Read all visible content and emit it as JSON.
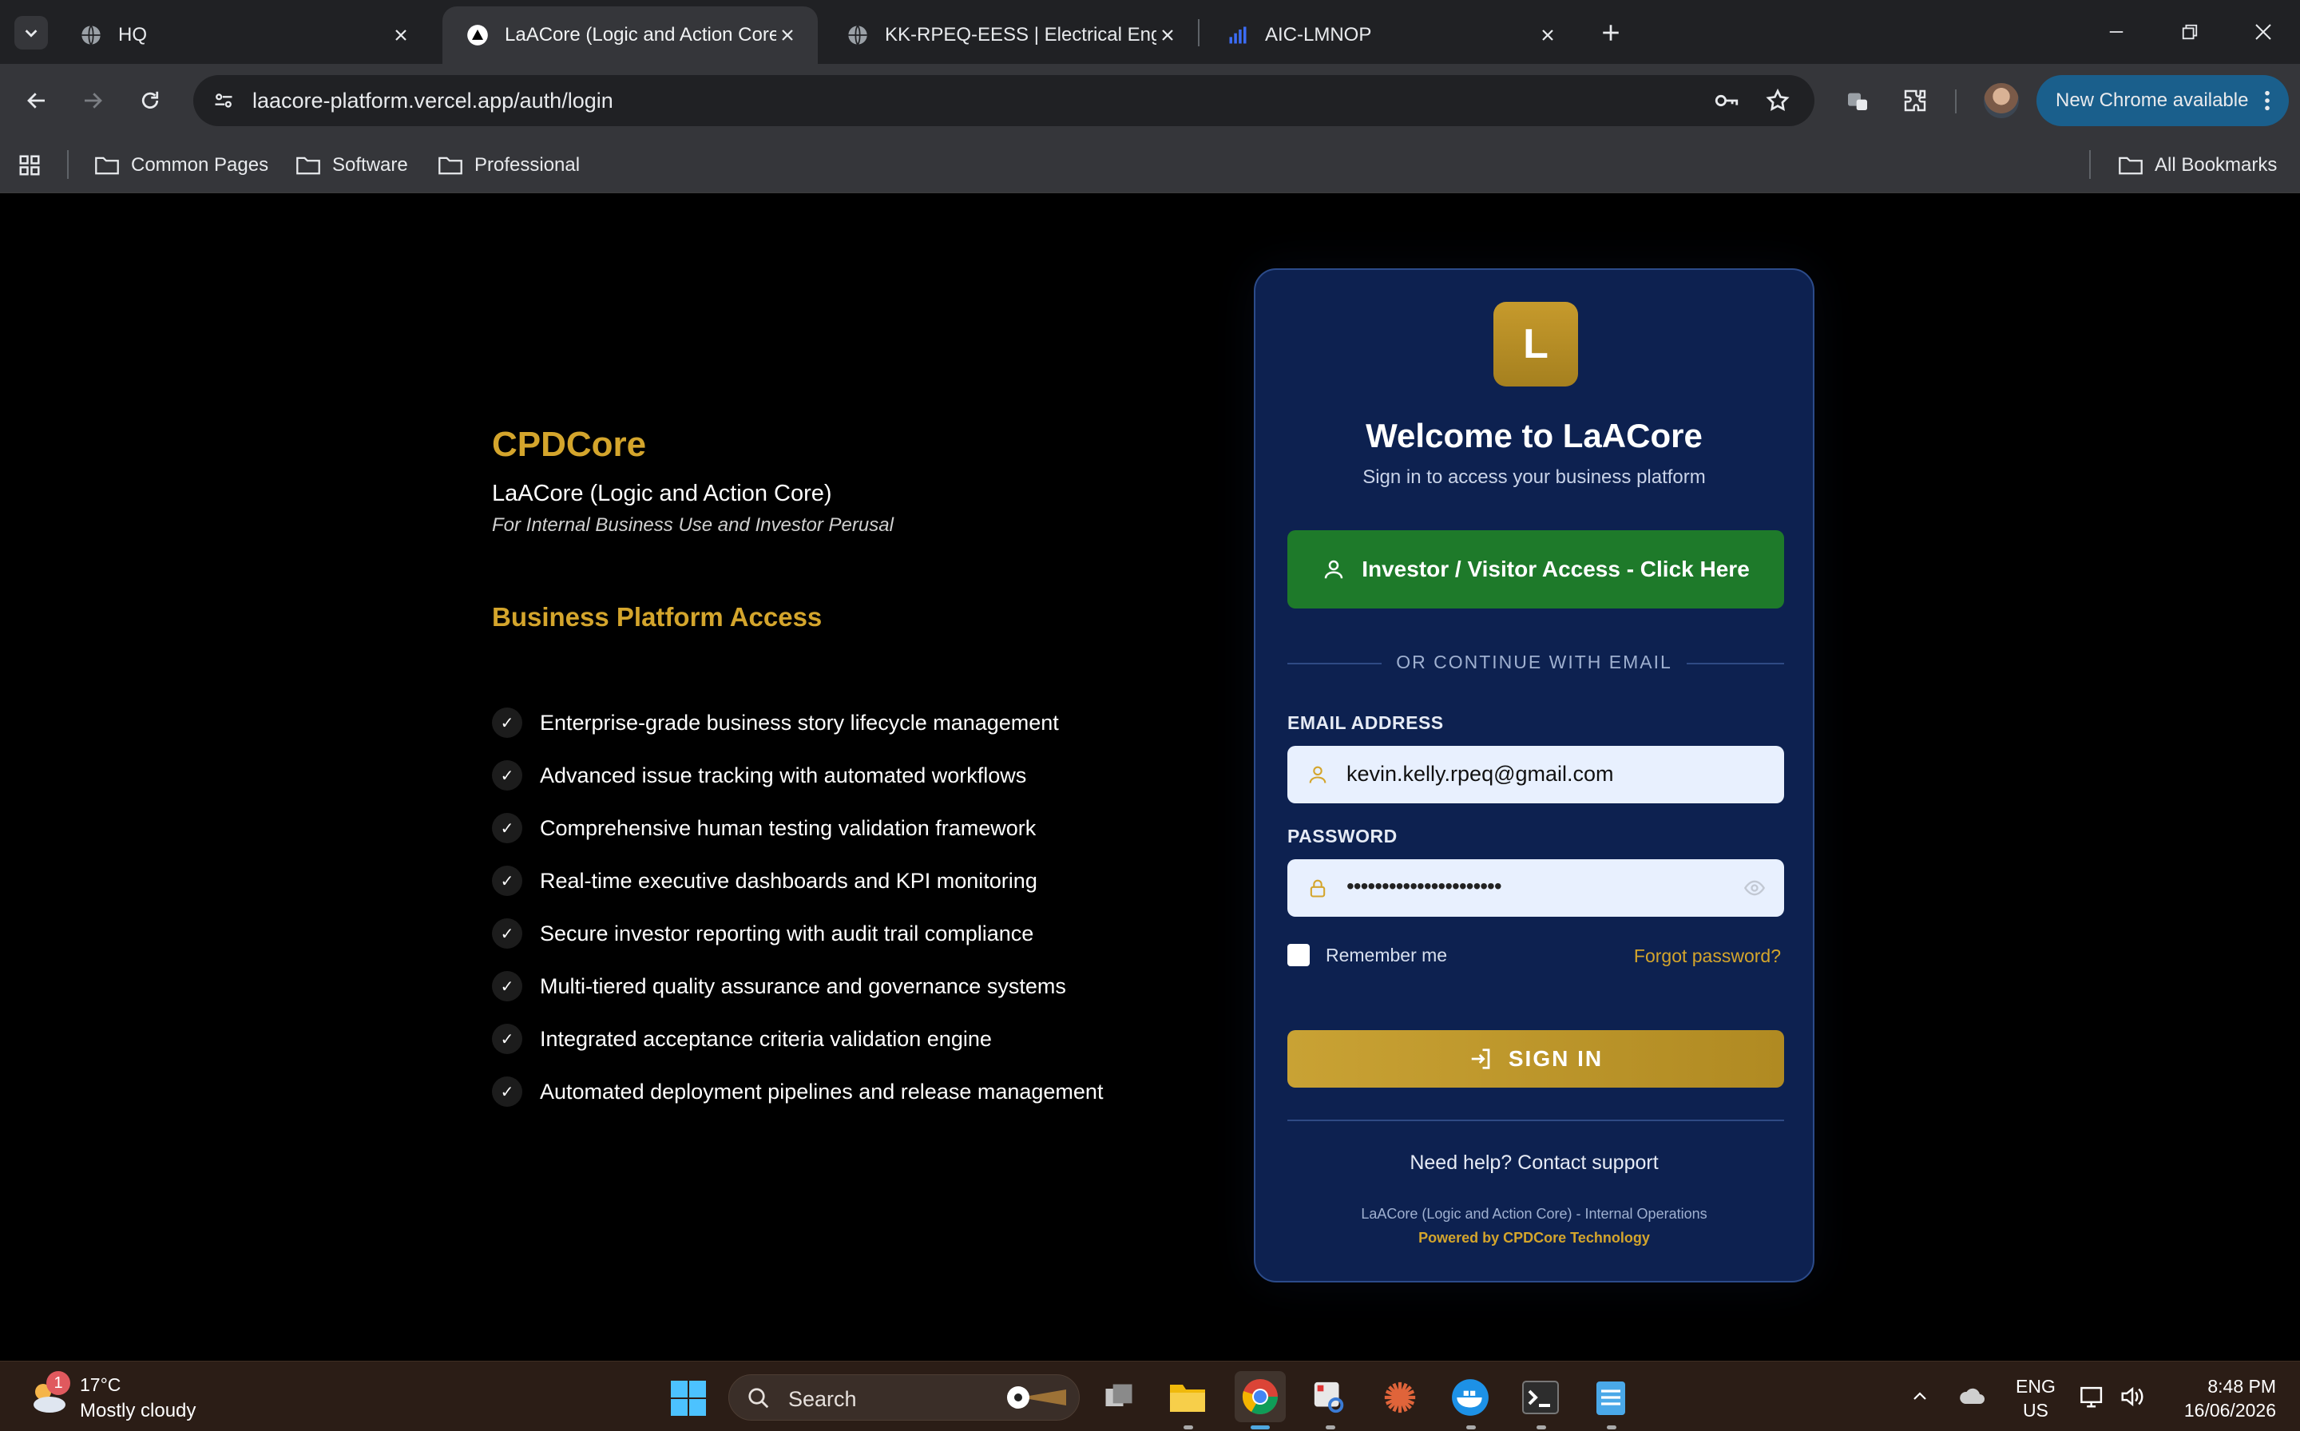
{
  "browser": {
    "tabs": [
      {
        "title": "HQ",
        "active": false
      },
      {
        "title": "LaACore (Logic and Action Core",
        "active": true
      },
      {
        "title": "KK-RPEQ-EESS | Electrical Engin",
        "active": false
      },
      {
        "title": "AIC-LMNOP",
        "active": false
      }
    ],
    "url": "laacore-platform.vercel.app/auth/login",
    "update_label": "New Chrome available",
    "bookmarks": [
      "Common Pages",
      "Software",
      "Professional"
    ],
    "all_bookmarks": "All Bookmarks"
  },
  "left": {
    "brand": "CPDCore",
    "subtitle": "LaACore (Logic and Action Core)",
    "tagline": "For Internal Business Use and Investor Perusal",
    "section_title": "Business Platform Access",
    "check_glyph": "✓",
    "features": [
      "Enterprise-grade business story lifecycle management",
      "Advanced issue tracking with automated workflows",
      "Comprehensive human testing validation framework",
      "Real-time executive dashboards and KPI monitoring",
      "Secure investor reporting with audit trail compliance",
      "Multi-tiered quality assurance and governance systems",
      "Integrated acceptance criteria validation engine",
      "Automated deployment pipelines and release management"
    ]
  },
  "card": {
    "logo_letter": "L",
    "title": "Welcome to LaACore",
    "subtitle": "Sign in to access your business platform",
    "investor_button": "Investor / Visitor Access - Click Here",
    "divider": "OR CONTINUE WITH EMAIL",
    "email_label": "EMAIL ADDRESS",
    "email_value": "kevin.kelly.rpeq@gmail.com",
    "password_label": "PASSWORD",
    "password_value": "••••••••••••••••••••••",
    "remember_label": "Remember me",
    "remember_checked": false,
    "forgot_label": "Forgot password?",
    "signin_label": "SIGN IN",
    "help": "Need help? Contact support",
    "footer_line1": "LaACore (Logic and Action Core) - Internal Operations",
    "footer_line2": "Powered by CPDCore Technology"
  },
  "taskbar": {
    "weather_badge": "1",
    "temperature": "17°C",
    "condition": "Mostly cloudy",
    "search_placeholder": "Search",
    "lang_line1": "ENG",
    "lang_line2": "US",
    "time": "8:48 PM",
    "date": "16/06/2026"
  },
  "colors": {
    "accent_gold": "#d4a52c",
    "card_bg": "#0d2150",
    "investor_green": "#1e7a2a",
    "chrome_update": "#1a5f8c"
  }
}
